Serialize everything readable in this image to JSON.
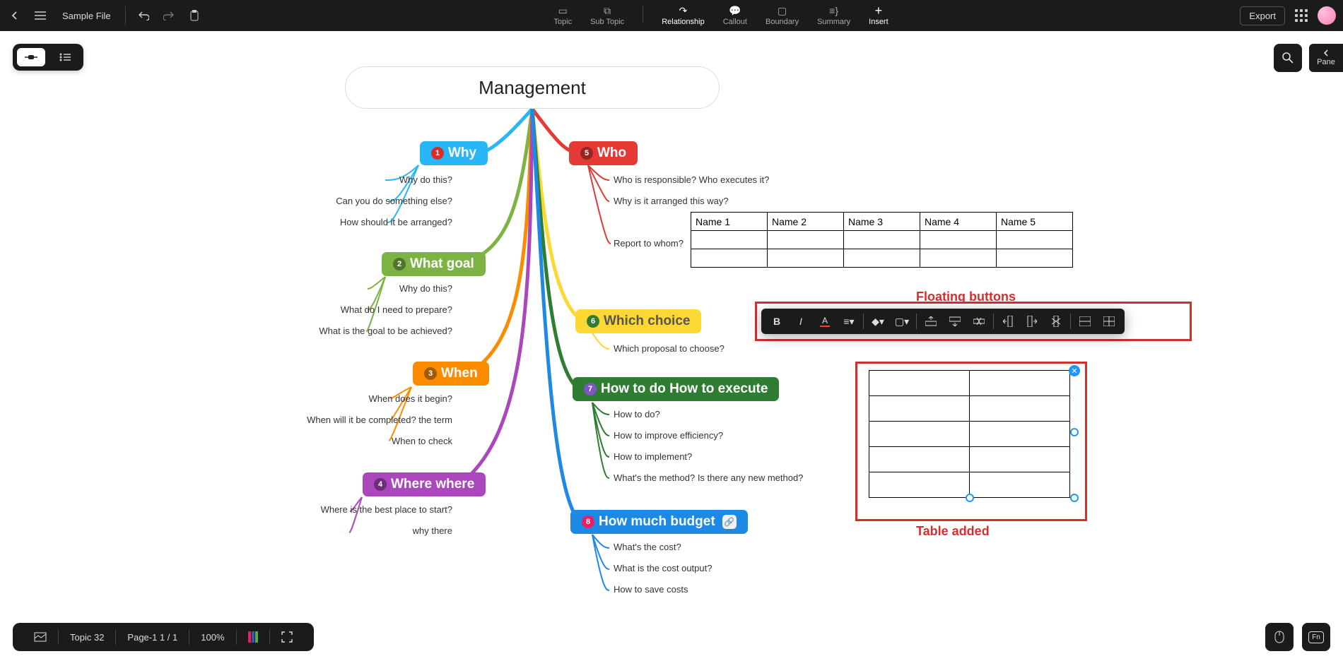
{
  "header": {
    "file_title": "Sample File",
    "tools": [
      {
        "id": "topic",
        "label": "Topic"
      },
      {
        "id": "subtopic",
        "label": "Sub Topic"
      },
      {
        "id": "relationship",
        "label": "Relationship"
      },
      {
        "id": "callout",
        "label": "Callout"
      },
      {
        "id": "boundary",
        "label": "Boundary"
      },
      {
        "id": "summary",
        "label": "Summary"
      },
      {
        "id": "insert",
        "label": "Insert"
      }
    ],
    "export_label": "Export",
    "panel_label": "Pane"
  },
  "mindmap": {
    "root": "Management",
    "left": [
      {
        "num": "1",
        "label": "Why",
        "color": "why-c",
        "subs": [
          "Why do this?",
          "Can you do something else?",
          "How should it be arranged?"
        ]
      },
      {
        "num": "2",
        "label": "What goal",
        "color": "goal-c",
        "subs": [
          "Why do this?",
          "What do I need to prepare?",
          "What is the goal to be achieved?"
        ]
      },
      {
        "num": "3",
        "label": "When",
        "color": "when-c",
        "subs": [
          "When does it begin?",
          "When will it be completed? the term",
          "When to check"
        ]
      },
      {
        "num": "4",
        "label": "Where where",
        "color": "where-c",
        "subs": [
          "Where is the best place to start?",
          "why there"
        ]
      }
    ],
    "right": [
      {
        "num": "5",
        "label": "Who",
        "color": "who-c",
        "subs": [
          "Who is responsible? Who executes it?",
          "Why is it arranged this way?",
          "Report to whom?"
        ]
      },
      {
        "num": "6",
        "label": "Which choice",
        "color": "choice-c",
        "subs": [
          "Which proposal to choose?"
        ]
      },
      {
        "num": "7",
        "label": "How to do How to execute",
        "color": "howdo-c",
        "subs": [
          "How to do?",
          "How to improve efficiency?",
          "How to implement?",
          "What's the method? Is there any new method?"
        ]
      },
      {
        "num": "8",
        "label": "How much budget",
        "color": "budget-c",
        "attach": true,
        "subs": [
          "What's the cost?",
          "What is the cost output?",
          "How to save costs"
        ]
      }
    ]
  },
  "table1": {
    "headers": [
      "Name 1",
      "Name 2",
      "Name 3",
      "Name 4",
      "Name 5"
    ]
  },
  "annotations": {
    "floating": "Floating buttons",
    "added": "Table added"
  },
  "status": {
    "topic": "Topic 32",
    "page": "Page-1  1 / 1",
    "zoom": "100%"
  }
}
